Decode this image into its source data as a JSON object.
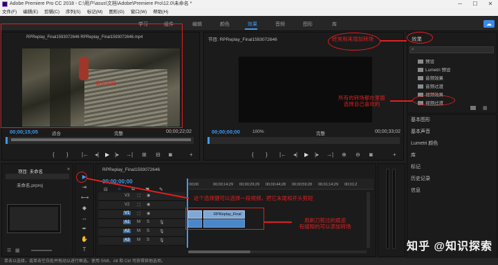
{
  "titlebar": {
    "title": "Adobe Premiere Pro CC 2018 - C:\\用户\\asus\\文档\\Adobe\\Premiere Pro\\12.0\\未命名 *",
    "minimize": "─",
    "maximize": "☐",
    "close": "✕"
  },
  "menubar": [
    "文件(F)",
    "编辑(E)",
    "剪辑(C)",
    "序列(S)",
    "标记(M)",
    "图形(G)",
    "窗口(W)",
    "帮助(H)"
  ],
  "workspaces": [
    "学习",
    "组件",
    "编辑",
    "颜色",
    "效果",
    "音频",
    "图形",
    "库"
  ],
  "active_workspace": "效果",
  "source_monitor": {
    "tab": "RPReplay_Final1593072646 RPReplay_Final1593072646.mp4",
    "timecode_in": "00;00;15;05",
    "fit": "适合",
    "quality": "完整",
    "timecode_out": "00;00;22;02"
  },
  "program_monitor": {
    "tab": "节目: RPReplay_Final1593072646",
    "timecode_in": "00;00;00;00",
    "zoom": "100%",
    "quality": "完整",
    "timecode_out": "00;00;33;02"
  },
  "effects_panel": {
    "tab": "效果",
    "items": [
      "预设",
      "Lumetri 预设",
      "音频效果",
      "音频过渡",
      "视频效果",
      "视频过渡"
    ]
  },
  "right_panels": [
    "基本图形",
    "基本声音",
    "Lumetri 颜色",
    "库",
    "标记",
    "历史记录",
    "信息"
  ],
  "project_panel": {
    "tab": "项目: 未命名",
    "file": "未命名.prproj"
  },
  "timeline": {
    "tab": "RPReplay_Final1593072646",
    "timecode": "00;00;00;00",
    "ruler": [
      ":00;00",
      "00;00;14;29",
      "00;00;29;29",
      "00;00;44;28",
      "00;00;59;28",
      "00;01;14;29",
      "00;01;2"
    ],
    "tracks": [
      {
        "name": "V3",
        "type": "video"
      },
      {
        "name": "V2",
        "type": "video"
      },
      {
        "name": "V1",
        "type": "video"
      },
      {
        "name": "A1",
        "type": "audio"
      },
      {
        "name": "A2",
        "type": "audio"
      },
      {
        "name": "A3",
        "type": "audio"
      }
    ],
    "clip_label": "RPReplay_Final"
  },
  "status_bar": "单击以选择，或单击空白处并拖动以进行框选。使用 Shift、Alt 和 Ctrl 可获得其他选项。",
  "annotations": {
    "source_video": "我是视频",
    "effects_hint": "经常用来增加转场",
    "transitions_hint": "所有的转场都在里面\n选择自己喜欢的",
    "select_tool": "这个选择键可以选择一段视频，把它末尾和开头剪短",
    "razor_hint": "用剃刀剪过的痕迹\n有缝隙的可以添加转场"
  },
  "watermark": "知乎 @知识探索"
}
